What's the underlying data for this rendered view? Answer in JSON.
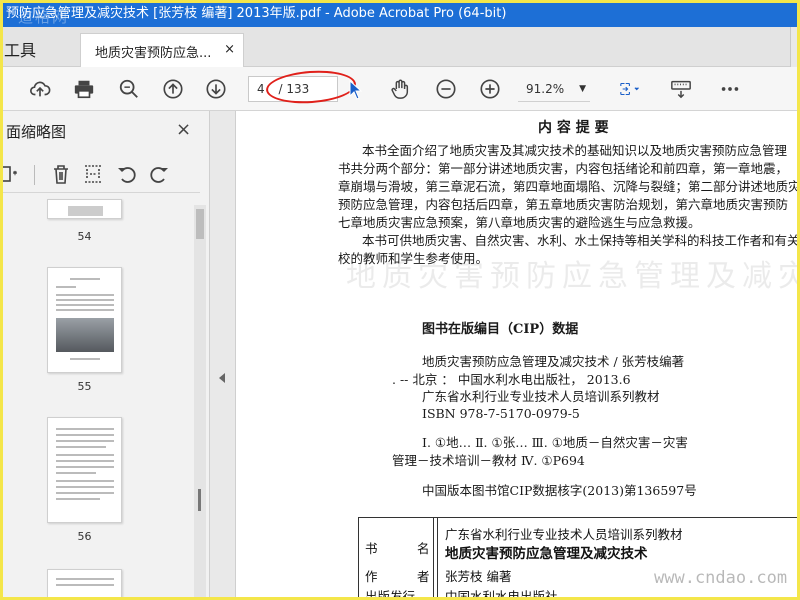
{
  "window": {
    "title": "预防应急管理及减灾技术 [张芳枝 编著] 2013年版.pdf - Adobe Acrobat Pro (64-bit)",
    "watermark": "道格网"
  },
  "tabs": {
    "tools_label": "工具",
    "doc_label": "地质灾害预防应急...",
    "close_glyph": "×"
  },
  "toolbar": {
    "page_current": "4",
    "page_total": "/ 133",
    "zoom": "91.2%",
    "icons": [
      "cloud-upload-icon",
      "print-icon",
      "search-zoom-icon",
      "arrow-up-icon",
      "arrow-down-icon",
      "select-cursor-icon",
      "hand-icon",
      "zoom-out-icon",
      "zoom-in-icon",
      "fit-page-icon",
      "keyboard-icon",
      "more-icon"
    ]
  },
  "sidebar": {
    "title": "面缩略图",
    "close_glyph": "×",
    "pages": [
      {
        "num": "54"
      },
      {
        "num": "55"
      },
      {
        "num": "56"
      }
    ]
  },
  "document": {
    "heading": "内 容 提 要",
    "summary_lines": [
      "本书全面介绍了地质灾害及其减灾技术的基础知识以及地质灾害预防应急管理",
      "书共分两个部分：第一部分讲述地质灾害，内容包括绪论和前四章，第一章地震，",
      "章崩塌与滑坡，第三章泥石流，第四章地面塌陷、沉降与裂缝；第二部分讲述地质灾",
      "预防应急管理，内容包括后四章，第五章地质灾害防治规划，第六章地质灾害预防",
      "七章地质灾害应急预案，第八章地质灾害的避险逃生与应急救援。"
    ],
    "audience_lines": [
      "本书可供地质灾害、自然灾害、水利、水土保持等相关学科的科技工作者和有关",
      "校的教师和学生参考使用。"
    ],
    "cip_title": "图书在版编目（CIP）数据",
    "cip_lines": [
      "地质灾害预防应急管理及减灾技术 / 张芳枝编著",
      ". -- 北京 ： 中国水利水电出版社， 2013.6",
      "广东省水利行业专业技术人员培训系列教材",
      "ISBN 978-7-5170-0979-5"
    ],
    "class_lines": [
      "Ⅰ. ①地…  Ⅱ. ①张…  Ⅲ. ①地质－自然灾害－灾害",
      "管理－技术培训－教材  Ⅳ. ①P694"
    ],
    "cip_number": "中国版本图书馆CIP数据核字(2013)第136597号",
    "table": {
      "row1_label_a": "书",
      "row1_label_b": "名",
      "row1_value1": "广东省水利行业专业技术人员培训系列教材",
      "row1_value2": "地质灾害预防应急管理及减灾技术",
      "row2_label_a": "作",
      "row2_label_b": "者",
      "row2_value": "张芳枝  编著",
      "row3_label": "出版发行",
      "row3_value": "中国水利水电出版社"
    },
    "watermark": "www.cndao.com"
  }
}
